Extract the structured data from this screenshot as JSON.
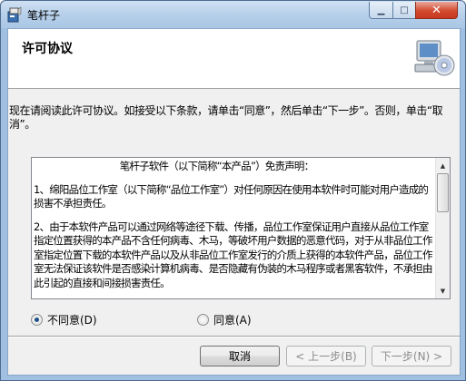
{
  "window": {
    "title": "笔杆子"
  },
  "header": {
    "title": "许可协议"
  },
  "instruction": "现在请阅读此许可协议。如接受以下条款，请单击“同意”，然后单击“下一步”。否则，单击“取消”。",
  "license": {
    "title": "笔杆子软件（以下简称“本产品”）免责声明：",
    "paragraphs": [
      "1、绵阳品位工作室（以下简称“品位工作室”）对任何原因在使用本软件时可能对用户造成的损害不承担责任。",
      "2、由于本软件产品可以通过网络等途径下载、传播，品位工作室保证用户直接从品位工作室指定位置获得的本产品不含任何病毒、木马，等破坏用户数据的恶意代码，对于从非品位工作室指定位置下载的本软件产品以及从非品位工作室发行的介质上获得的本软件产品，品位工作室无法保证该软件是否感染计算机病毒、是否隐藏有伪装的木马程序或者黑客软件，不承担由此引起的直接和间接损害责任。"
    ]
  },
  "options": {
    "disagree_label": "不同意(D)",
    "agree_label": "同意(A)",
    "selected": "disagree"
  },
  "buttons": {
    "cancel": "取消",
    "back": "< 上一步(B)",
    "next": "下一步(N) >"
  },
  "icons": {
    "app": "app-installer-icon",
    "header": "computer-cd-icon"
  }
}
